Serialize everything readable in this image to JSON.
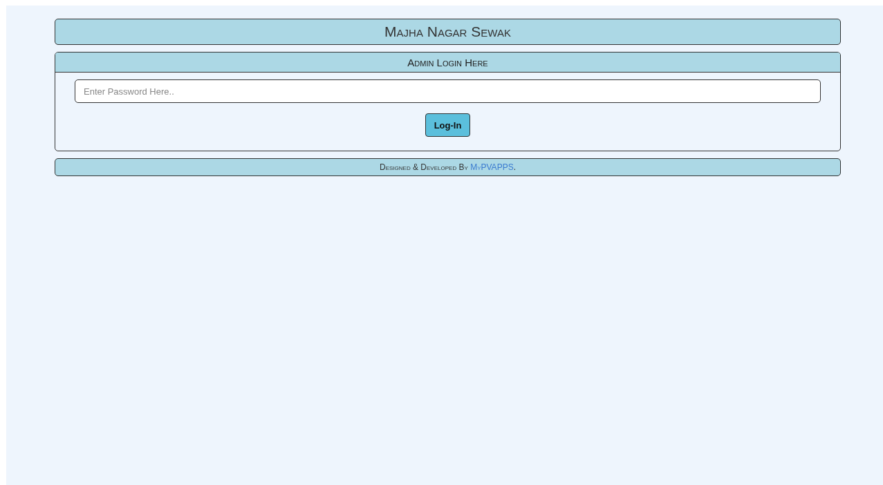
{
  "header": {
    "title": "Majha Nagar Sewak"
  },
  "login_panel": {
    "title": "Admin Login Here",
    "password": {
      "placeholder": "Enter Password Here.."
    },
    "button": "Log-In"
  },
  "footer": {
    "text": "Designed & Developed By ",
    "link": "MyPVAPPS",
    "suffix": "."
  }
}
